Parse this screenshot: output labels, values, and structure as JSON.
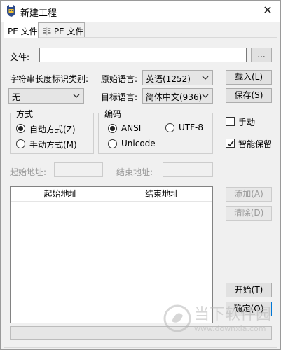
{
  "window": {
    "title": "新建工程",
    "close_glyph": "✕"
  },
  "tabs": [
    {
      "label": "PE 文件",
      "active": true
    },
    {
      "label": "非 PE 文件",
      "active": false
    }
  ],
  "file": {
    "label": "文件:",
    "value": "",
    "browse_label": "..."
  },
  "string_length": {
    "label": "字符串长度标识类别:",
    "selected": "无"
  },
  "source_lang": {
    "label": "原始语言:",
    "selected": "英语(1252)"
  },
  "target_lang": {
    "label": "目标语言:",
    "selected": "简体中文(936)"
  },
  "mode_group": {
    "title": "方式",
    "options": [
      {
        "label": "自动方式(Z)",
        "checked": true
      },
      {
        "label": "手动方式(M)",
        "checked": false
      }
    ]
  },
  "encoding_group": {
    "title": "编码",
    "options": [
      {
        "label": "ANSI",
        "checked": true
      },
      {
        "label": "UTF-8",
        "checked": false
      },
      {
        "label": "Unicode",
        "checked": false
      }
    ]
  },
  "side_buttons": {
    "load": "载入(L)",
    "save": "保存(S)",
    "manual_label": "手动",
    "manual_checked": false,
    "smart_label": "智能保留",
    "smart_checked": true
  },
  "address": {
    "start_label": "起始地址:",
    "end_label": "结束地址:",
    "start_value": "",
    "end_value": ""
  },
  "range_table": {
    "columns": [
      "起始地址",
      "结束地址"
    ],
    "rows": []
  },
  "range_buttons": {
    "add": "添加(A)",
    "clear": "清除(D)"
  },
  "bottom_buttons": {
    "start": "开始(T)",
    "ok": "确定(O)"
  },
  "watermark": {
    "text_cn": "当下软件园",
    "text_url": "www.downxia.com"
  },
  "colors": {
    "accent": "#0078d7",
    "watermark": "#b7b7b7"
  }
}
